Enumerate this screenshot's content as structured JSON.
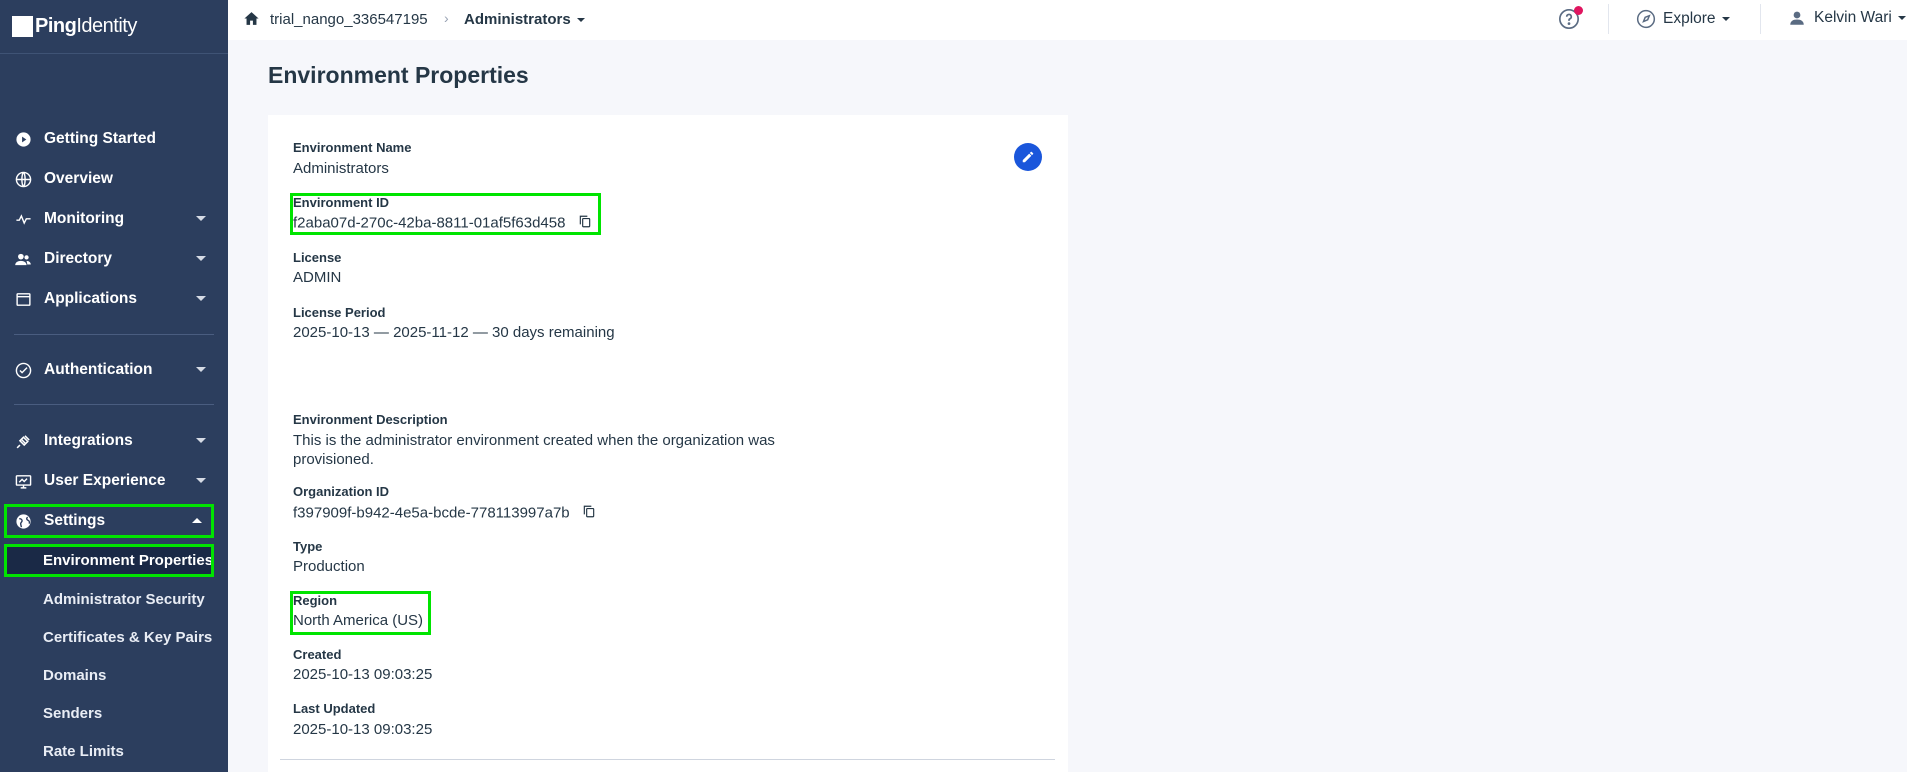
{
  "logo": {
    "brand": "Ping",
    "suffix": "Identity"
  },
  "breadcrumb": {
    "environment": "trial_nango_336547195",
    "separator": "›",
    "current": "Administrators"
  },
  "header": {
    "explore_label": "Explore",
    "user_name": "Kelvin Wari"
  },
  "sidebar": {
    "items": [
      {
        "label": "Getting Started",
        "icon": "play-circle-icon"
      },
      {
        "label": "Overview",
        "icon": "globe-icon"
      },
      {
        "label": "Monitoring",
        "icon": "pulse-icon"
      },
      {
        "label": "Directory",
        "icon": "users-icon"
      },
      {
        "label": "Applications",
        "icon": "window-icon"
      },
      {
        "label": "Authentication",
        "icon": "check-circle-icon"
      },
      {
        "label": "Integrations",
        "icon": "plug-icon"
      },
      {
        "label": "User Experience",
        "icon": "monitor-icon"
      },
      {
        "label": "Settings",
        "icon": "globe-settings-icon"
      }
    ],
    "settings_sub": [
      "Environment Properties",
      "Administrator Security",
      "Certificates & Key Pairs",
      "Domains",
      "Senders",
      "Rate Limits"
    ]
  },
  "main": {
    "title": "Environment Properties",
    "fields": {
      "env_name_label": "Environment Name",
      "env_name_value": "Administrators",
      "env_id_label": "Environment ID",
      "env_id_value": "f2aba07d-270c-42ba-8811-01af5f63d458",
      "license_label": "License",
      "license_value": "ADMIN",
      "license_period_label": "License Period",
      "license_period_value": "2025-10-13 — 2025-11-12 — 30 days remaining",
      "description_label": "Environment Description",
      "description_line1": "This is the administrator environment created when the organization was",
      "description_line2": "provisioned.",
      "org_id_label": "Organization ID",
      "org_id_value": "f397909f-b942-4e5a-bcde-778113997a7b",
      "type_label": "Type",
      "type_value": "Production",
      "region_label": "Region",
      "region_value": "North America (US)",
      "created_label": "Created",
      "created_value": "2025-10-13 09:03:25",
      "updated_label": "Last Updated",
      "updated_value": "2025-10-13 09:03:25"
    }
  },
  "colors": {
    "sidebar_bg": "#2c3e5e",
    "active_sub_bg": "#1a2946",
    "highlight": "#00e400",
    "edit_button": "#1a56db",
    "notification": "#e0155f"
  }
}
